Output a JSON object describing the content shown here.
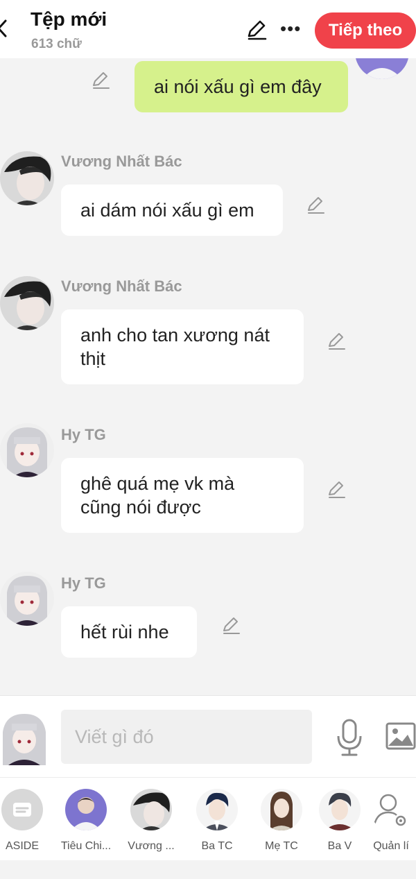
{
  "header": {
    "title": "Tệp mới",
    "word_count": "613 chữ",
    "follow_label": "Tiếp theo"
  },
  "messages": [
    {
      "side": "right",
      "text_lines": [
        "ai nói xấu gì em đây"
      ]
    },
    {
      "side": "left",
      "name": "Vương Nhất Bác",
      "text_lines": [
        "ai dám nói xấu gì em"
      ]
    },
    {
      "side": "left",
      "name": "Vương Nhất Bác",
      "text_lines": [
        "anh cho tan xương nát",
        "thịt"
      ]
    },
    {
      "side": "left",
      "name": "Hy TG",
      "text_lines": [
        "ghê quá mẹ vk mà",
        "cũng nói được"
      ]
    },
    {
      "side": "left",
      "name": "Hy TG",
      "text_lines": [
        "hết rùi nhe"
      ]
    }
  ],
  "composer": {
    "placeholder": "Viết gì đó"
  },
  "characters": [
    {
      "label": "ASIDE"
    },
    {
      "label": "Tiêu Chi..."
    },
    {
      "label": "Vương ..."
    },
    {
      "label": "Ba TC"
    },
    {
      "label": "Mẹ TC"
    },
    {
      "label": "Ba V"
    },
    {
      "label": "Quản lí"
    }
  ],
  "colors": {
    "accent": "#f0424a",
    "my_bubble": "#d6f18c",
    "background": "#f3f3f3"
  }
}
